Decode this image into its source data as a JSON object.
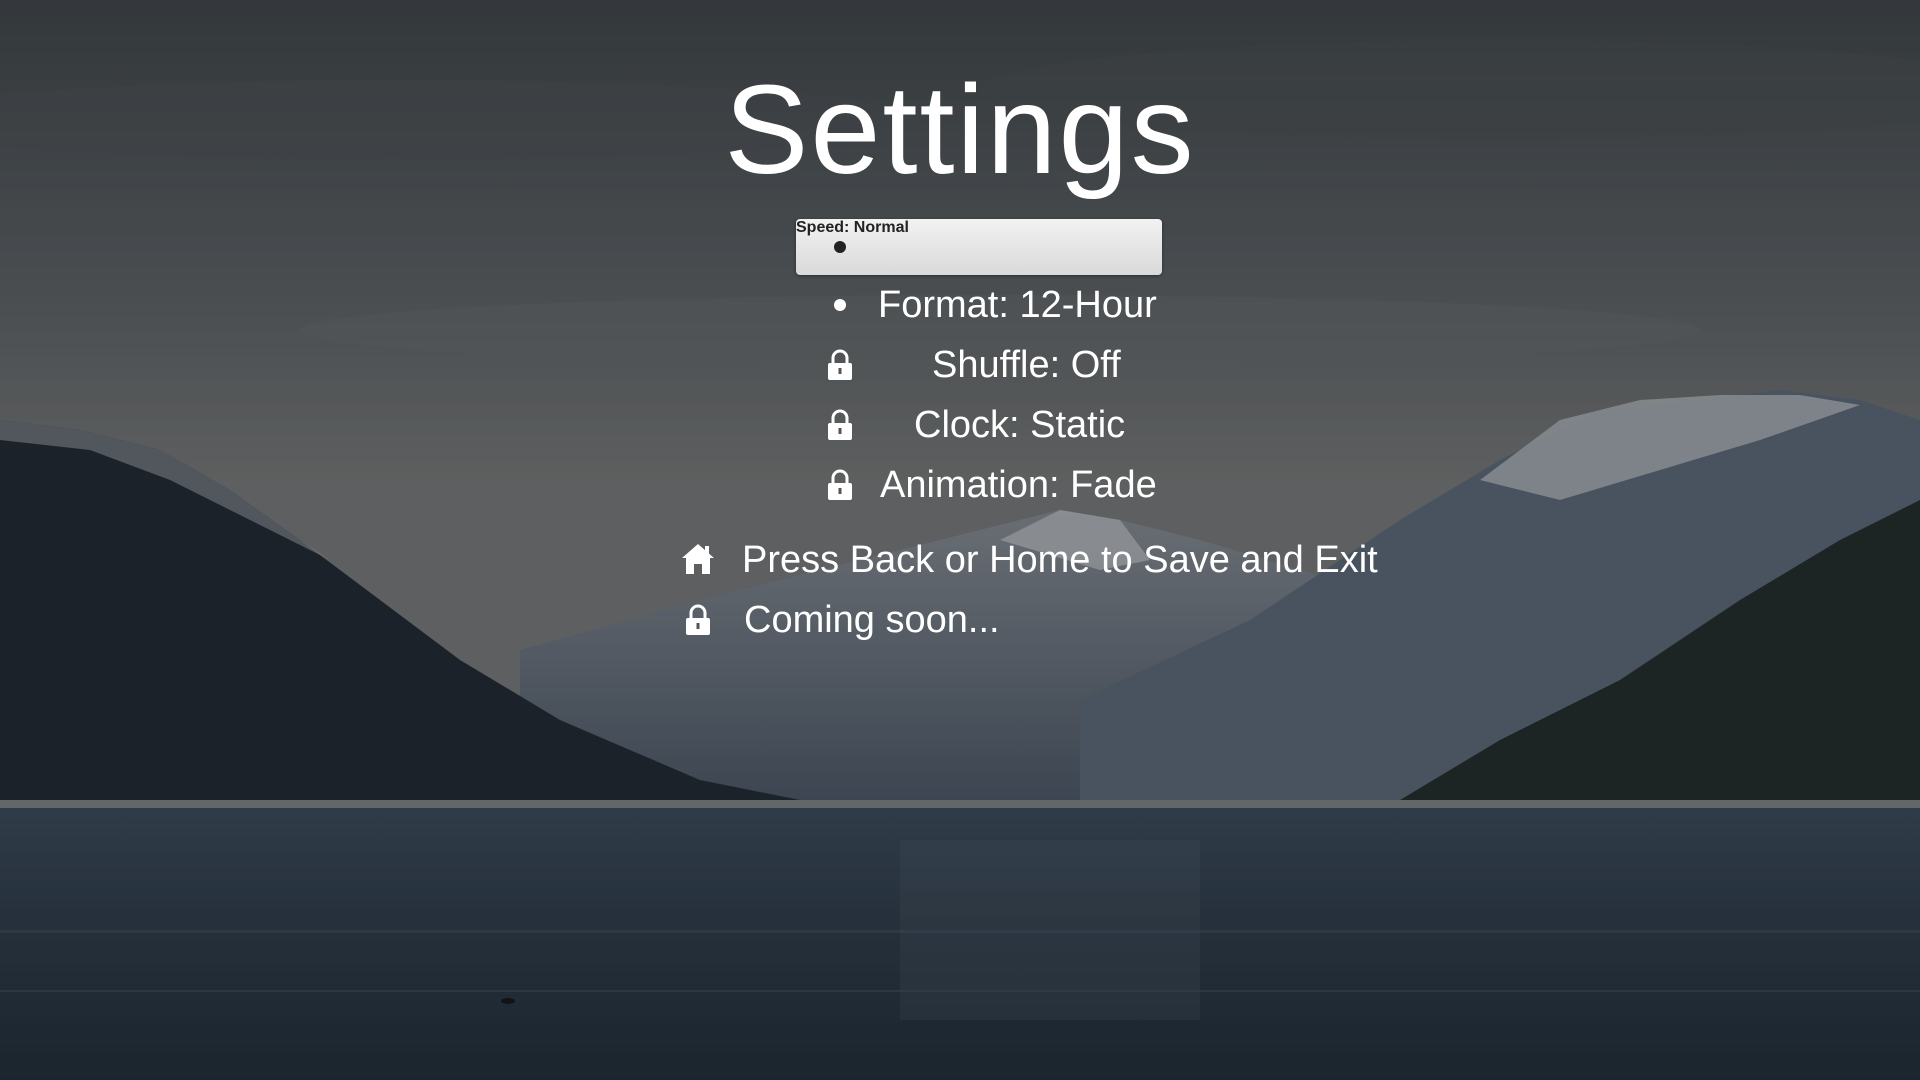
{
  "screen": {
    "title": "Settings"
  },
  "menu": {
    "items": [
      {
        "label": "Speed: Normal",
        "icon": "bullet-icon",
        "selected": true,
        "locked": false
      },
      {
        "label": "Format: 12-Hour",
        "icon": "bullet-icon",
        "selected": false,
        "locked": false
      },
      {
        "label": "Shuffle: Off",
        "icon": "lock-icon",
        "selected": false,
        "locked": true
      },
      {
        "label": "Clock: Static",
        "icon": "lock-icon",
        "selected": false,
        "locked": true
      },
      {
        "label": "Animation: Fade",
        "icon": "lock-icon",
        "selected": false,
        "locked": true
      }
    ]
  },
  "footer": {
    "hint": "Press Back or Home to Save and Exit",
    "hint_icon": "home-icon",
    "coming_soon": "Coming soon...",
    "coming_soon_icon": "lock-icon"
  },
  "colors": {
    "text": "#ffffff",
    "selected_bg": "#e6e6e6",
    "selected_text": "#222222"
  }
}
